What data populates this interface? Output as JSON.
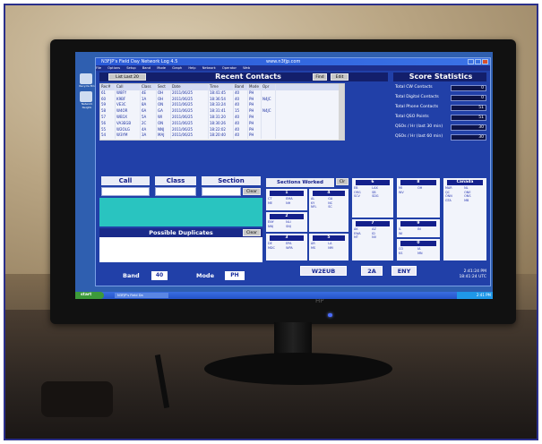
{
  "window": {
    "title": "N3FJP's Field Day Network Log 4.5",
    "title_extra": "www.n3fjp.com",
    "menu": [
      "File",
      "Options",
      "Setup",
      "Band",
      "Mode",
      "Graph",
      "Help",
      "Network",
      "Operator",
      "Web"
    ]
  },
  "desktop_icons": [
    "Recycle Bin",
    "Network Neighb"
  ],
  "toolbar": {
    "list_all_button": "List Last 20",
    "edit_button": "Edit",
    "find_button": "Find"
  },
  "recent": {
    "title": "Recent Contacts",
    "columns": [
      "Rec#",
      "Call",
      "Class",
      "Sect",
      "Date",
      "Time",
      "Band",
      "Mode",
      "Opr"
    ],
    "rows": [
      [
        "61",
        "W8FY",
        "4E",
        "OH",
        "2011/06/25",
        "18:41:45",
        "40",
        "PH",
        ""
      ],
      [
        "60",
        "K9BF",
        "1A",
        "OH",
        "2011/06/25",
        "18:36:54",
        "40",
        "PH",
        "N4JC"
      ],
      [
        "59",
        "VE3C",
        "8A",
        "ON",
        "2011/06/25",
        "18:33:24",
        "40",
        "PH",
        ""
      ],
      [
        "58",
        "W4OR",
        "6A",
        "GA",
        "2011/06/25",
        "18:31:41",
        "15",
        "PH",
        "N4JC"
      ],
      [
        "57",
        "WB1X",
        "5A",
        "WI",
        "2011/06/25",
        "18:31:20",
        "40",
        "PH",
        ""
      ],
      [
        "56",
        "VA3EGB",
        "2C",
        "ON",
        "2011/06/25",
        "18:30:26",
        "40",
        "PH",
        ""
      ],
      [
        "55",
        "W2OLG",
        "4A",
        "NNJ",
        "2011/06/25",
        "18:22:02",
        "40",
        "PH",
        ""
      ],
      [
        "54",
        "W3YM",
        "3A",
        "MAJ",
        "2011/06/25",
        "18:20:40",
        "40",
        "PH",
        ""
      ]
    ]
  },
  "stats": {
    "title": "Score Statistics",
    "items": [
      {
        "label": "Total CW Contacts",
        "value": "0"
      },
      {
        "label": "Total Digital Contacts",
        "value": "0"
      },
      {
        "label": "Total Phone Contacts",
        "value": "51"
      },
      {
        "label": "Total QSO Points",
        "value": "51"
      },
      {
        "label": "QSOs / Hr (last 30 min)",
        "value": "30"
      },
      {
        "label": "QSOs / Hr (last 60 min)",
        "value": "30"
      }
    ]
  },
  "entry": {
    "call_label": "Call",
    "class_label": "Class",
    "section_label": "Section",
    "clear_button": "Clear",
    "call_value": "",
    "class_value": "",
    "section_value": ""
  },
  "duplicates": {
    "title": "Possible Duplicates",
    "clear_button": "Clear"
  },
  "band": {
    "label": "Band",
    "value": "40"
  },
  "mode": {
    "label": "Mode",
    "value": "PH"
  },
  "sections_worked": {
    "title": "Sections Worked",
    "button": "Clr"
  },
  "regions": [
    {
      "id": "1",
      "sections": [
        "CT",
        "EMA",
        "ME",
        "NH",
        "RI",
        "VT",
        "WMA",
        "WMA"
      ]
    },
    {
      "id": "2",
      "sections": [
        "ENY",
        "NLI",
        "NNJ",
        "SNJ",
        "WNY",
        "NNY"
      ]
    },
    {
      "id": "3",
      "sections": [
        "DE",
        "EPA",
        "MDC",
        "WPA"
      ]
    },
    {
      "id": "4",
      "sections": [
        "AL",
        "GA",
        "KY",
        "NC",
        "NFL",
        "SC",
        "SFL",
        "WCF",
        "TN",
        "VA",
        "PR",
        "VI"
      ]
    },
    {
      "id": "5",
      "sections": [
        "AR",
        "LA",
        "MS",
        "NM",
        "NTX",
        "OK",
        "STX",
        "WTX"
      ]
    },
    {
      "id": "6",
      "sections": [
        "EB",
        "LAX",
        "ORG",
        "SB",
        "SCV",
        "SDG",
        "SF",
        "SJV",
        "SV",
        "PAC"
      ]
    },
    {
      "id": "7",
      "sections": [
        "AK",
        "AZ",
        "EWA",
        "ID",
        "MT",
        "NV",
        "OR",
        "UT",
        "WWA",
        "WY"
      ]
    },
    {
      "id": "8",
      "sections": [
        "MI",
        "OH",
        "WV"
      ]
    },
    {
      "id": "9",
      "sections": [
        "IL",
        "IN",
        "WI"
      ]
    },
    {
      "id": "0",
      "sections": [
        "CO",
        "IA",
        "KS",
        "MN",
        "MO",
        "NE",
        "ND",
        "SD"
      ]
    },
    {
      "id": "Canada",
      "sections": [
        "MAR",
        "NL",
        "QC",
        "ONE",
        "ONN",
        "ONS",
        "GTA",
        "MB",
        "SK",
        "AB",
        "BC",
        "NT"
      ]
    }
  ],
  "footer": {
    "station": "W2EUB",
    "class": "2A",
    "section": "ENY"
  },
  "clock": {
    "local": "2:41:24 PM",
    "utc": "18:41:24 UTC"
  },
  "taskbar": {
    "start": "start",
    "task": "N3FJP's Field Da",
    "tray_time": "2:41 PM"
  },
  "monitor_brand": "HP"
}
